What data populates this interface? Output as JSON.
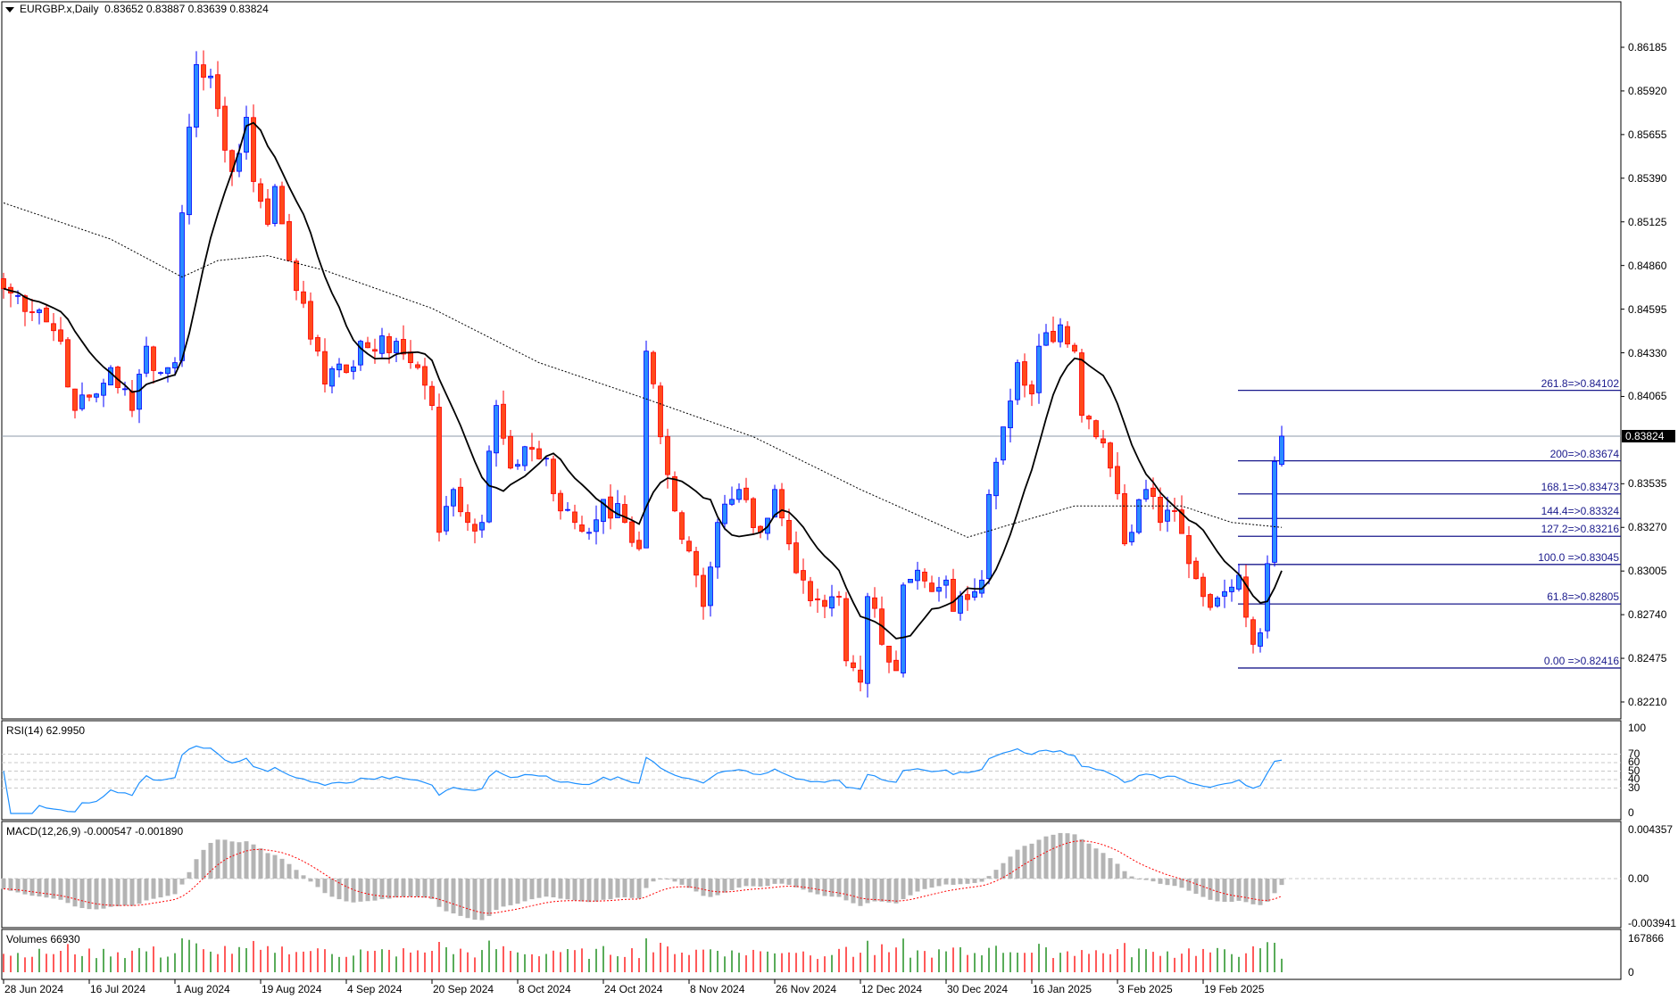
{
  "header": {
    "symbol": "EURGBP.x,Daily",
    "open": "0.83652",
    "high": "0.83887",
    "low": "0.83639",
    "close": "0.83824"
  },
  "colors": {
    "bull_fill": "#2a8cff",
    "bull_edge": "#0000ff",
    "bear_fill": "#ff4a1a",
    "bear_edge": "#ff0000",
    "fib": "#1a1a8c",
    "rsi": "#1e90ff",
    "macd_hist": "#b4b4b4",
    "macd_signal": "#ff0000",
    "vol_up": "#008000",
    "vol_down": "#ff0000",
    "grid": "#c8c8c8",
    "price_line": "#8c9aa8"
  },
  "price_axis": [
    "0.86185",
    "0.85920",
    "0.85655",
    "0.85390",
    "0.85125",
    "0.84860",
    "0.84595",
    "0.84330",
    "0.84065",
    "0.83535",
    "0.83270",
    "0.83005",
    "0.82740",
    "0.82475",
    "0.82210"
  ],
  "current_price": "0.83824",
  "fib_levels": [
    {
      "label": "261.8=>0.84102",
      "price": 0.84102
    },
    {
      "label": "200=>0.83674",
      "price": 0.83674
    },
    {
      "label": "168.1=>0.83473",
      "price": 0.83473
    },
    {
      "label": "144.4=>0.83324",
      "price": 0.83324
    },
    {
      "label": "127.2=>0.83216",
      "price": 0.83216
    },
    {
      "label": "100.0 =>0.83045",
      "price": 0.83045
    },
    {
      "label": "61.8=>0.82805",
      "price": 0.82805
    },
    {
      "label": "0.00 =>0.82416",
      "price": 0.82416
    }
  ],
  "rsi": {
    "label": "RSI(14) 62.9950",
    "axis": [
      "100",
      "70",
      "60",
      "50",
      "40",
      "30",
      "0"
    ],
    "levels": [
      70,
      60,
      50,
      40,
      30
    ]
  },
  "macd": {
    "label": "MACD(12,26,9) -0.000547 -0.001890",
    "axis": [
      "0.004357",
      "0.00",
      "-0.003941"
    ]
  },
  "volumes": {
    "label": "Volumes 66930",
    "axis": [
      "167866",
      "0"
    ],
    "max": 167866
  },
  "dates": [
    {
      "label": "28 Jun 2024",
      "bar": 0
    },
    {
      "label": "16 Jul 2024",
      "bar": 12
    },
    {
      "label": "1 Aug 2024",
      "bar": 24
    },
    {
      "label": "19 Aug 2024",
      "bar": 36
    },
    {
      "label": "4 Sep 2024",
      "bar": 48
    },
    {
      "label": "20 Sep 2024",
      "bar": 60
    },
    {
      "label": "8 Oct 2024",
      "bar": 72
    },
    {
      "label": "24 Oct 2024",
      "bar": 84
    },
    {
      "label": "8 Nov 2024",
      "bar": 96
    },
    {
      "label": "26 Nov 2024",
      "bar": 108
    },
    {
      "label": "12 Dec 2024",
      "bar": 120
    },
    {
      "label": "30 Dec 2024",
      "bar": 132
    },
    {
      "label": "16 Jan 2025",
      "bar": 144
    },
    {
      "label": "3 Feb 2025",
      "bar": 156
    },
    {
      "label": "19 Feb 2025",
      "bar": 168
    }
  ],
  "chart_data": {
    "type": "candlestick",
    "bars": 180,
    "close_keypoints": [
      [
        0,
        0.8472
      ],
      [
        5,
        0.8459
      ],
      [
        8,
        0.844
      ],
      [
        10,
        0.8398
      ],
      [
        13,
        0.8408
      ],
      [
        15,
        0.8424
      ],
      [
        18,
        0.8398
      ],
      [
        20,
        0.8437
      ],
      [
        22,
        0.8421
      ],
      [
        24,
        0.8427
      ],
      [
        25,
        0.8518
      ],
      [
        26,
        0.857
      ],
      [
        27,
        0.8608
      ],
      [
        29,
        0.8601
      ],
      [
        31,
        0.8556
      ],
      [
        32,
        0.8543
      ],
      [
        34,
        0.8576
      ],
      [
        35,
        0.8537
      ],
      [
        37,
        0.8511
      ],
      [
        38,
        0.8534
      ],
      [
        40,
        0.8489
      ],
      [
        42,
        0.8463
      ],
      [
        44,
        0.8434
      ],
      [
        45,
        0.8414
      ],
      [
        48,
        0.8421
      ],
      [
        50,
        0.844
      ],
      [
        52,
        0.8434
      ],
      [
        55,
        0.844
      ],
      [
        57,
        0.8427
      ],
      [
        58,
        0.8424
      ],
      [
        60,
        0.8401
      ],
      [
        61,
        0.8324
      ],
      [
        63,
        0.835
      ],
      [
        65,
        0.833
      ],
      [
        67,
        0.833
      ],
      [
        69,
        0.8401
      ],
      [
        71,
        0.8363
      ],
      [
        73,
        0.8376
      ],
      [
        76,
        0.8369
      ],
      [
        78,
        0.8337
      ],
      [
        80,
        0.833
      ],
      [
        82,
        0.8324
      ],
      [
        84,
        0.8344
      ],
      [
        87,
        0.833
      ],
      [
        89,
        0.8314
      ],
      [
        90,
        0.8434
      ],
      [
        92,
        0.8382
      ],
      [
        94,
        0.8337
      ],
      [
        97,
        0.8298
      ],
      [
        98,
        0.8279
      ],
      [
        100,
        0.833
      ],
      [
        102,
        0.8344
      ],
      [
        103,
        0.835
      ],
      [
        106,
        0.8324
      ],
      [
        108,
        0.835
      ],
      [
        110,
        0.8317
      ],
      [
        112,
        0.8295
      ],
      [
        115,
        0.8279
      ],
      [
        117,
        0.8285
      ],
      [
        118,
        0.8246
      ],
      [
        120,
        0.8233
      ],
      [
        121,
        0.8285
      ],
      [
        123,
        0.8256
      ],
      [
        125,
        0.824
      ],
      [
        126,
        0.8292
      ],
      [
        128,
        0.8301
      ],
      [
        130,
        0.8288
      ],
      [
        132,
        0.8295
      ],
      [
        133,
        0.8276
      ],
      [
        136,
        0.8288
      ],
      [
        137,
        0.8295
      ],
      [
        138,
        0.8347
      ],
      [
        140,
        0.8388
      ],
      [
        142,
        0.8427
      ],
      [
        144,
        0.8408
      ],
      [
        145,
        0.8437
      ],
      [
        148,
        0.845
      ],
      [
        150,
        0.8434
      ],
      [
        151,
        0.8395
      ],
      [
        153,
        0.8382
      ],
      [
        155,
        0.8363
      ],
      [
        157,
        0.8317
      ],
      [
        158,
        0.8324
      ],
      [
        160,
        0.835
      ],
      [
        162,
        0.833
      ],
      [
        164,
        0.8337
      ],
      [
        166,
        0.8305
      ],
      [
        168,
        0.8285
      ],
      [
        171,
        0.8288
      ],
      [
        173,
        0.8298
      ],
      [
        175,
        0.8256
      ],
      [
        176,
        0.8263
      ],
      [
        177,
        0.8305
      ],
      [
        178,
        0.8367
      ],
      [
        179,
        0.83824
      ]
    ],
    "slow_ma_keypoints": [
      [
        0,
        0.8524
      ],
      [
        15,
        0.8502
      ],
      [
        25,
        0.8479
      ],
      [
        30,
        0.8489
      ],
      [
        37,
        0.8492
      ],
      [
        45,
        0.8483
      ],
      [
        60,
        0.846
      ],
      [
        75,
        0.8427
      ],
      [
        90,
        0.8405
      ],
      [
        105,
        0.8382
      ],
      [
        120,
        0.835
      ],
      [
        135,
        0.8321
      ],
      [
        142,
        0.833
      ],
      [
        150,
        0.834
      ],
      [
        165,
        0.834
      ],
      [
        172,
        0.833
      ],
      [
        179,
        0.8327
      ]
    ],
    "last_bar": {
      "open": 0.83652,
      "high": 0.83887,
      "low": 0.83639,
      "close": 0.83824
    },
    "ylim": [
      0.8221,
      0.86185
    ]
  }
}
